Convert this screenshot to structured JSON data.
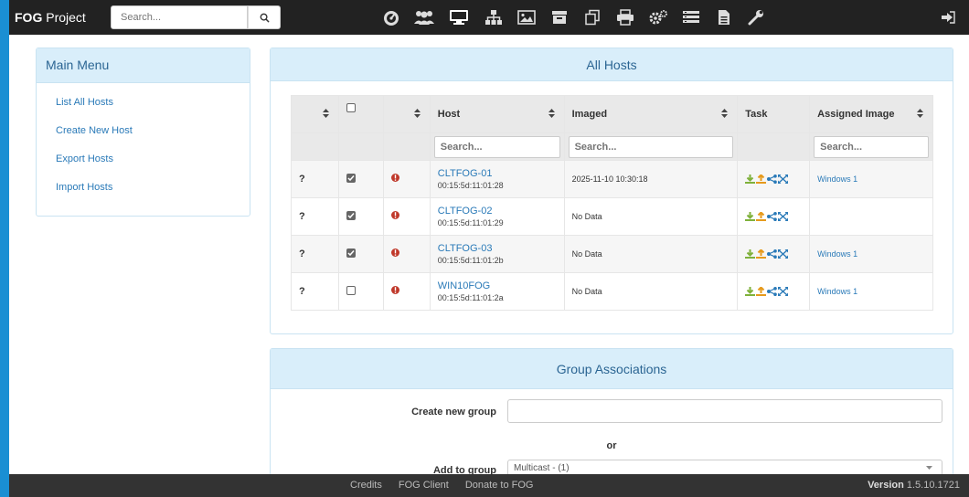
{
  "app": {
    "brand_bold": "FOG",
    "brand_rest": " Project"
  },
  "search": {
    "placeholder": "Search..."
  },
  "nav_icons": [
    "dashboard-icon",
    "users-icon",
    "hosts-icon",
    "groups-icon",
    "images-icon",
    "storage-icon",
    "snapins-icon",
    "printers-icon",
    "service-config-icon",
    "tasks-icon",
    "reports-icon",
    "settings-icon",
    "logout-icon"
  ],
  "sidebar": {
    "title": "Main Menu",
    "items": [
      {
        "label": "List All Hosts"
      },
      {
        "label": "Create New Host"
      },
      {
        "label": "Export Hosts"
      },
      {
        "label": "Import Hosts"
      }
    ]
  },
  "hosts_panel": {
    "title": "All Hosts",
    "columns": {
      "host": "Host",
      "imaged": "Imaged",
      "task": "Task",
      "assigned_image": "Assigned Image"
    },
    "filter_placeholder": "Search...",
    "rows": [
      {
        "status": "?",
        "checked": true,
        "host": "CLTFOG-01",
        "mac": "00:15:5d:11:01:28",
        "imaged": "2025-11-10 10:30:18",
        "image": "Windows 1"
      },
      {
        "status": "?",
        "checked": true,
        "host": "CLTFOG-02",
        "mac": "00:15:5d:11:01:29",
        "imaged": "No Data",
        "image": ""
      },
      {
        "status": "?",
        "checked": true,
        "host": "CLTFOG-03",
        "mac": "00:15:5d:11:01:2b",
        "imaged": "No Data",
        "image": "Windows 1"
      },
      {
        "status": "?",
        "checked": false,
        "host": "WIN10FOG",
        "mac": "00:15:5d:11:01:2a",
        "imaged": "No Data",
        "image": "Windows 1"
      }
    ]
  },
  "group_panel": {
    "title": "Group Associations",
    "create_label": "Create new group",
    "or_label": "or",
    "add_label": "Add to group",
    "select_value": "Multicast - (1)"
  },
  "footer": {
    "links": [
      "Credits",
      "FOG Client",
      "Donate to FOG"
    ],
    "version_label": "Version",
    "version_value": " 1.5.10.1721"
  },
  "colors": {
    "accent": "#1a8fd3",
    "link": "#2a7ab8",
    "panel_header": "#d9eefa",
    "topbar": "#222222",
    "footer": "#333333",
    "task_green": "#7fb13b",
    "task_orange": "#e69a1c",
    "task_blue": "#2a7ab8",
    "alert_red": "#c0392b"
  }
}
